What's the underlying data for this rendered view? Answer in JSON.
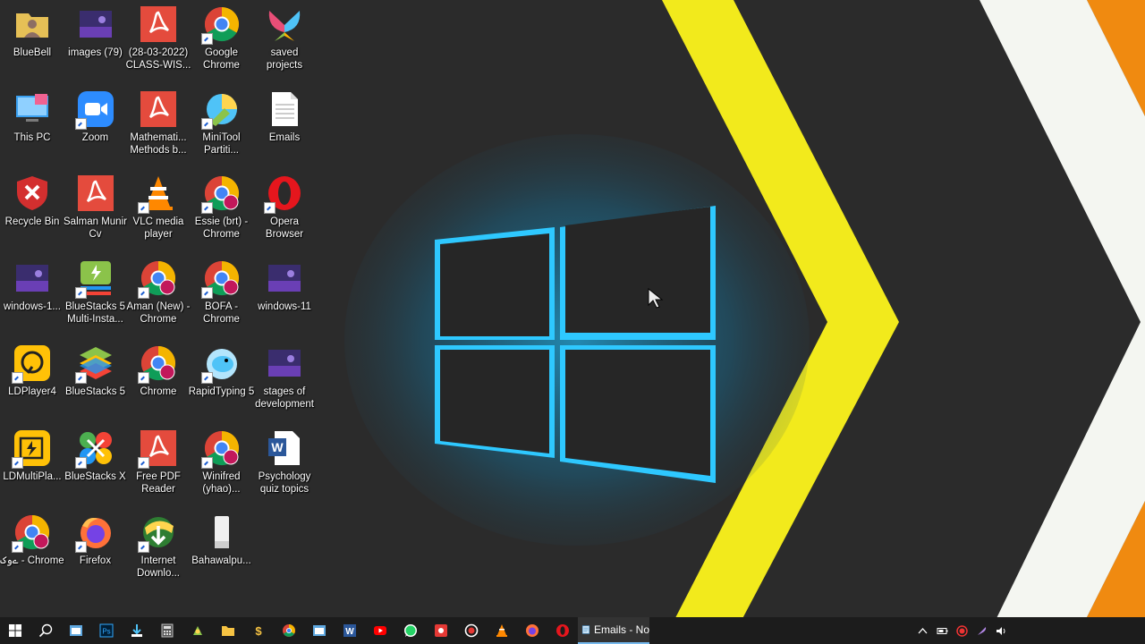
{
  "desktop": {
    "icons": [
      {
        "label": "BlueBell",
        "icon": "user-folder-icon"
      },
      {
        "label": "images (79)",
        "icon": "image-thumbnail-icon"
      },
      {
        "label": "(28-03-2022) CLASS-WIS...",
        "icon": "pdf-icon"
      },
      {
        "label": "Google Chrome",
        "icon": "chrome-icon"
      },
      {
        "label": "saved projects",
        "icon": "butterfly-app-icon"
      },
      {
        "label": "This PC",
        "icon": "this-pc-icon"
      },
      {
        "label": "Zoom",
        "icon": "zoom-icon"
      },
      {
        "label": "Mathemati... Methods b...",
        "icon": "pdf-icon"
      },
      {
        "label": "MiniTool Partiti...",
        "icon": "minitool-icon"
      },
      {
        "label": "Emails",
        "icon": "text-file-icon"
      },
      {
        "label": "Recycle Bin",
        "icon": "recycle-bin-icon"
      },
      {
        "label": "Salman Munir Cv",
        "icon": "pdf-icon"
      },
      {
        "label": "VLC media player",
        "icon": "vlc-icon"
      },
      {
        "label": "Essie (brt) - Chrome",
        "icon": "chrome-profile-icon"
      },
      {
        "label": "Opera Browser",
        "icon": "opera-icon"
      },
      {
        "label": "windows-1...",
        "icon": "image-thumbnail-icon"
      },
      {
        "label": "BlueStacks 5 Multi-Insta...",
        "icon": "bluestacks-multi-icon"
      },
      {
        "label": "Aman (New) - Chrome",
        "icon": "chrome-profile-icon"
      },
      {
        "label": "BOFA - Chrome",
        "icon": "chrome-profile-icon"
      },
      {
        "label": "windows-11",
        "icon": "image-thumbnail-icon"
      },
      {
        "label": "LDPlayer4",
        "icon": "ldplayer-icon"
      },
      {
        "label": "BlueStacks 5",
        "icon": "bluestacks-icon"
      },
      {
        "label": "Chrome",
        "icon": "chrome-profile-icon"
      },
      {
        "label": "RapidTyping 5",
        "icon": "rapidtyping-icon"
      },
      {
        "label": "stages of development",
        "icon": "image-thumbnail-icon"
      },
      {
        "label": "LDMultiPla...",
        "icon": "ldmultiplayer-icon"
      },
      {
        "label": "BlueStacks X",
        "icon": "bluestacks-x-icon"
      },
      {
        "label": "Free PDF Reader",
        "icon": "pdf-icon"
      },
      {
        "label": "Winifred (yhao)...",
        "icon": "chrome-profile-icon"
      },
      {
        "label": "Psychology quiz topics",
        "icon": "word-doc-icon"
      },
      {
        "label": "ےوک - Chrome",
        "icon": "chrome-profile-icon"
      },
      {
        "label": "Firefox",
        "icon": "firefox-icon"
      },
      {
        "label": "Internet Downlo...",
        "icon": "idm-icon"
      },
      {
        "label": "Bahawalpu...",
        "icon": "file-icon"
      }
    ]
  },
  "taskbar": {
    "pinned": [
      {
        "name": "start-button",
        "icon": "windows-logo-icon"
      },
      {
        "name": "search-button",
        "icon": "search-icon"
      },
      {
        "name": "taskbar-app-1",
        "icon": "window-app-icon"
      },
      {
        "name": "taskbar-photoshop",
        "icon": "photoshop-icon"
      },
      {
        "name": "taskbar-app-3",
        "icon": "download-app-icon"
      },
      {
        "name": "taskbar-calculator",
        "icon": "calculator-icon"
      },
      {
        "name": "taskbar-app-5",
        "icon": "gear-app-icon"
      },
      {
        "name": "taskbar-file-explorer",
        "icon": "folder-icon"
      },
      {
        "name": "taskbar-app-7",
        "icon": "dollar-icon"
      },
      {
        "name": "taskbar-chrome",
        "icon": "chrome-icon"
      },
      {
        "name": "taskbar-app-9",
        "icon": "window-app-icon"
      },
      {
        "name": "taskbar-word",
        "icon": "word-icon"
      },
      {
        "name": "taskbar-youtube",
        "icon": "youtube-icon"
      },
      {
        "name": "taskbar-whatsapp",
        "icon": "whatsapp-icon"
      },
      {
        "name": "taskbar-app-13",
        "icon": "red-app-icon"
      },
      {
        "name": "taskbar-record",
        "icon": "record-icon"
      },
      {
        "name": "taskbar-vlc",
        "icon": "vlc-icon"
      },
      {
        "name": "taskbar-firefox",
        "icon": "firefox-icon"
      },
      {
        "name": "taskbar-opera",
        "icon": "opera-icon"
      }
    ],
    "open_window": {
      "label": "Emails - No",
      "icon": "notepad-icon"
    }
  },
  "colors": {
    "wallpaper_bg": "#2b2b2b",
    "chevron_yellow": "#f2ea1c",
    "stripe_white": "#f4f6f1",
    "corner_orange": "#f08a10",
    "windows_glow": "#2ec8ff",
    "taskbar": "#1c1c1c"
  }
}
